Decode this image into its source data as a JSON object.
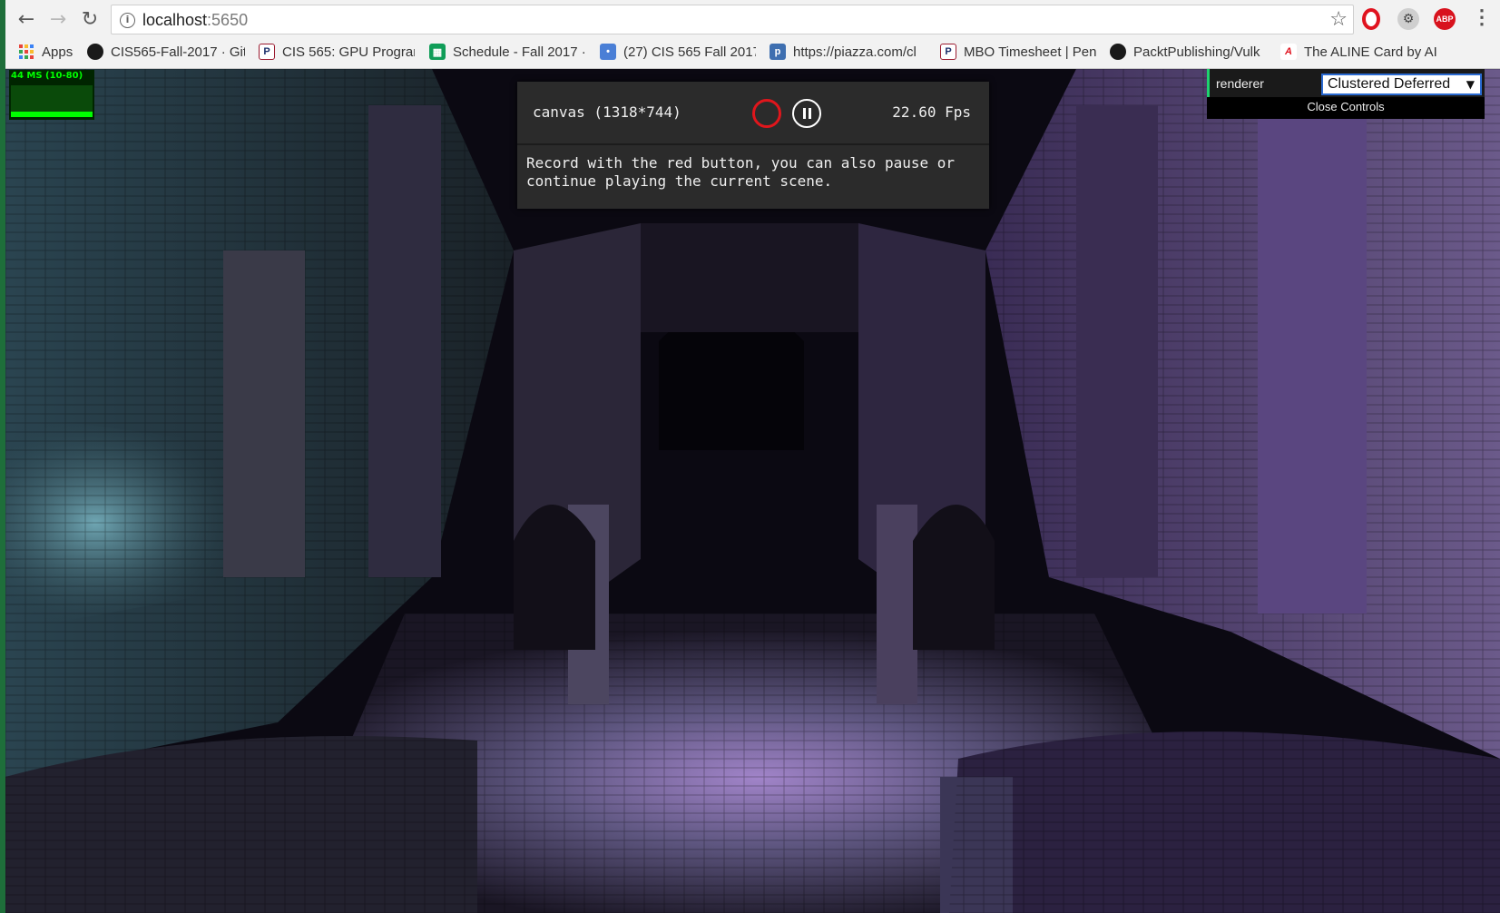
{
  "browser": {
    "url_host": "localhost",
    "url_port": ":5650",
    "bookmarks": [
      {
        "icon": "apps-icon",
        "label": "Apps"
      },
      {
        "icon": "github-icon",
        "label": "CIS565-Fall-2017 · Git"
      },
      {
        "icon": "penn-shield-icon",
        "label": "CIS 565: GPU Program"
      },
      {
        "icon": "sheets-icon",
        "label": "Schedule - Fall 2017 ·"
      },
      {
        "icon": "chat-icon",
        "label": "(27) CIS 565 Fall 2017"
      },
      {
        "icon": "piazza-icon",
        "label": "https://piazza.com/cl"
      },
      {
        "icon": "penn-shield-icon",
        "label": "MBO Timesheet | Pen"
      },
      {
        "icon": "github-icon",
        "label": "PacktPublishing/Vulk"
      },
      {
        "icon": "aline-icon",
        "label": "The ALINE Card by AI"
      }
    ],
    "extensions": {
      "abp_label": "ABP"
    }
  },
  "stats": {
    "label": "44 MS (10-80)"
  },
  "capture": {
    "canvas_label": "canvas (1318*744)",
    "fps": "22.60 Fps",
    "help": "Record with the red button, you can also pause or\ncontinue playing the current scene."
  },
  "gui": {
    "renderer_label": "renderer",
    "renderer_value": "Clustered Deferred",
    "close_label": "Close Controls"
  },
  "colors": {
    "accent_green": "#1ed36f",
    "record_red": "#e0161c",
    "select_border": "#2a6ad1"
  }
}
